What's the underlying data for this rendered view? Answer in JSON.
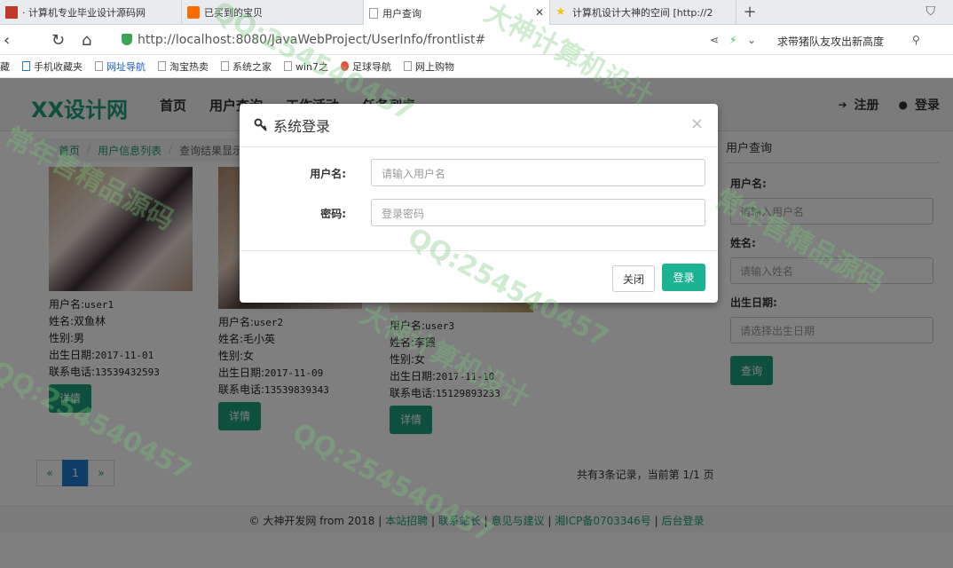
{
  "browser": {
    "tabs": [
      {
        "label": "· 计算机专业毕业设计源码网",
        "active": false
      },
      {
        "label": "已买到的宝贝",
        "active": false
      },
      {
        "label": "用户查询",
        "active": true
      },
      {
        "label": "计算机设计大神的空间 [http://2",
        "active": false
      }
    ],
    "new_tab": "+",
    "url": "http://localhost:8080/JavaWebProject/UserInfo/frontlist#",
    "search_hint": "求带猪队友攻出新高度",
    "bookmarks": [
      "藏",
      "手机收藏夹",
      "网址导航",
      "淘宝热卖",
      "系统之家",
      "win7之",
      "足球导航",
      "网上购物"
    ]
  },
  "navbar": {
    "brand": "XX设计网",
    "links": [
      "首页",
      "用户查询",
      "工作活动",
      "任务列表"
    ],
    "register": "注册",
    "login": "登录"
  },
  "breadcrumb": [
    "首页",
    "用户信息列表",
    "查询结果显示"
  ],
  "users": [
    {
      "username_label": "用户名:",
      "username": "user1",
      "name_label": "姓名:",
      "name": "双鱼林",
      "gender_label": "性别:",
      "gender": "男",
      "birth_label": "出生日期:",
      "birth": "2017-11-01",
      "phone_label": "联系电话:",
      "phone": "13539432593",
      "btn": "详情"
    },
    {
      "username_label": "用户名:",
      "username": "user2",
      "name_label": "姓名:",
      "name": "毛小英",
      "gender_label": "性别:",
      "gender": "女",
      "birth_label": "出生日期:",
      "birth": "2017-11-09",
      "phone_label": "联系电话:",
      "phone": "13539839343",
      "btn": "详情"
    },
    {
      "username_label": "用户名:",
      "username": "user3",
      "name_label": "姓名:",
      "name": "李霞",
      "gender_label": "性别:",
      "gender": "女",
      "birth_label": "出生日期:",
      "birth": "2017-11-10",
      "phone_label": "联系电话:",
      "phone": "15129893233",
      "btn": "详情"
    }
  ],
  "sidebar": {
    "title": "用户查询",
    "username_label": "用户名:",
    "username_placeholder": "请输入用户名",
    "name_label": "姓名:",
    "name_placeholder": "请输入姓名",
    "birth_label": "出生日期:",
    "birth_placeholder": "请选择出生日期",
    "search_btn": "查询"
  },
  "pager": {
    "prev": "«",
    "current": "1",
    "next": "»",
    "info": "共有3条记录，当前第 1/1 页"
  },
  "footer": {
    "copyright": "© 大神开发网 from 2018",
    "links": [
      "本站招聘",
      "联系站长",
      "意见与建议",
      "湘ICP备0703346号",
      "后台登录"
    ]
  },
  "modal": {
    "title": "系统登录",
    "close_x": "×",
    "username_label": "用户名:",
    "username_placeholder": "请输入用户名",
    "password_label": "密码:",
    "password_placeholder": "登录密码",
    "close_btn": "关闭",
    "login_btn": "登录"
  },
  "watermarks": [
    "QQ:254540457",
    "大神计算机设计",
    "常年售精品源码"
  ],
  "colors": {
    "accent": "#1c9e7a",
    "login_btn": "#1cb393",
    "pager_active": "#1c7bd1"
  }
}
